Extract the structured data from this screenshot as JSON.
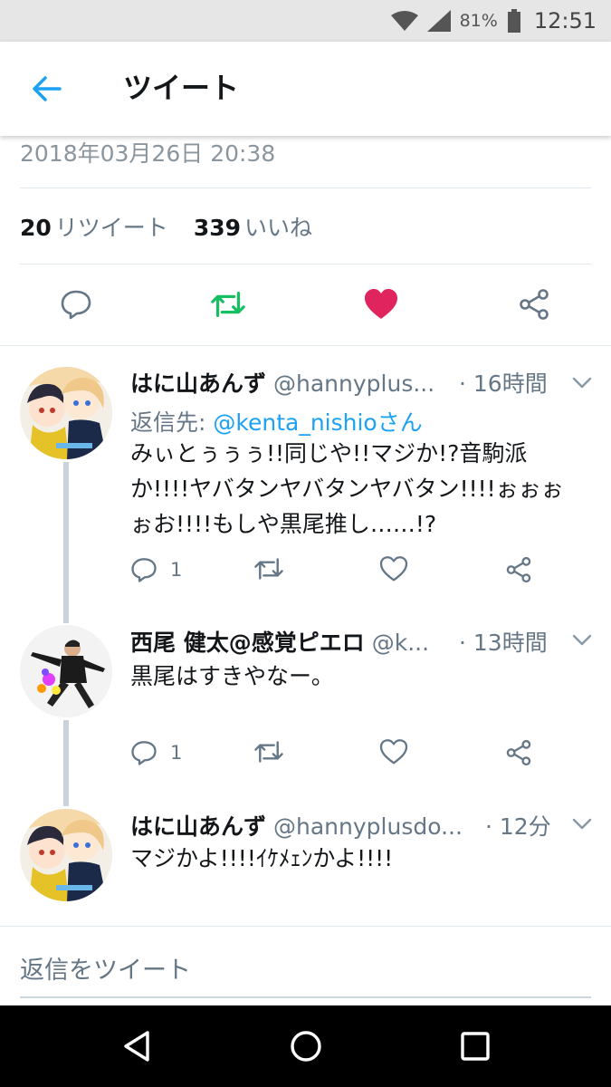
{
  "status_bar": {
    "battery": "81%",
    "time": "12:51",
    "icons": [
      "wifi-icon",
      "signal-icon",
      "battery-icon"
    ]
  },
  "header": {
    "back_icon": "arrow-left-icon",
    "title": "ツイート"
  },
  "tweet": {
    "date": "2018年03月26日 20:38",
    "retweet_count": "20",
    "retweet_label": "リツイート",
    "like_count": "339",
    "like_label": "いいね",
    "actions": [
      "reply-icon",
      "retweet-icon",
      "heart-icon",
      "share-icon"
    ],
    "colors": {
      "retweeted": "#17bf63",
      "liked": "#e0245e"
    }
  },
  "replies": [
    {
      "name": "はに山あんず",
      "handle": "@hannyplus...",
      "time": "· 16時間",
      "reply_to_label": "返信先:",
      "reply_to": "@kenta_nishioさん",
      "text_lines": [
        "みぃとぅぅぅ!!同じや!!マジか!?音駒派",
        "か!!!!ヤバタンヤバタンヤバタン!!!!ぉぉぉ",
        "ぉお!!!!もしや黒尾推し……!?"
      ],
      "reply_count": "1"
    },
    {
      "name": "西尾 健太@感覚ピエロ",
      "handle": "@k...",
      "time": "· 13時間",
      "text_lines": [
        "黒尾はすきやなー。"
      ],
      "reply_count": "1"
    },
    {
      "name": "はに山あんず",
      "handle": "@hannyplusdo...",
      "time": "· 12分",
      "text_lines": [
        "マジかよ!!!!ｲｹﾒｪﾝかよ!!!!"
      ]
    }
  ],
  "compose": {
    "placeholder": "返信をツイート"
  },
  "nav_bar": {
    "icons": [
      "back-triangle-icon",
      "home-circle-icon",
      "recents-square-icon"
    ]
  },
  "colors": {
    "link": "#1da1f2",
    "secondary_text": "#657786",
    "divider": "#e1e8ed"
  }
}
